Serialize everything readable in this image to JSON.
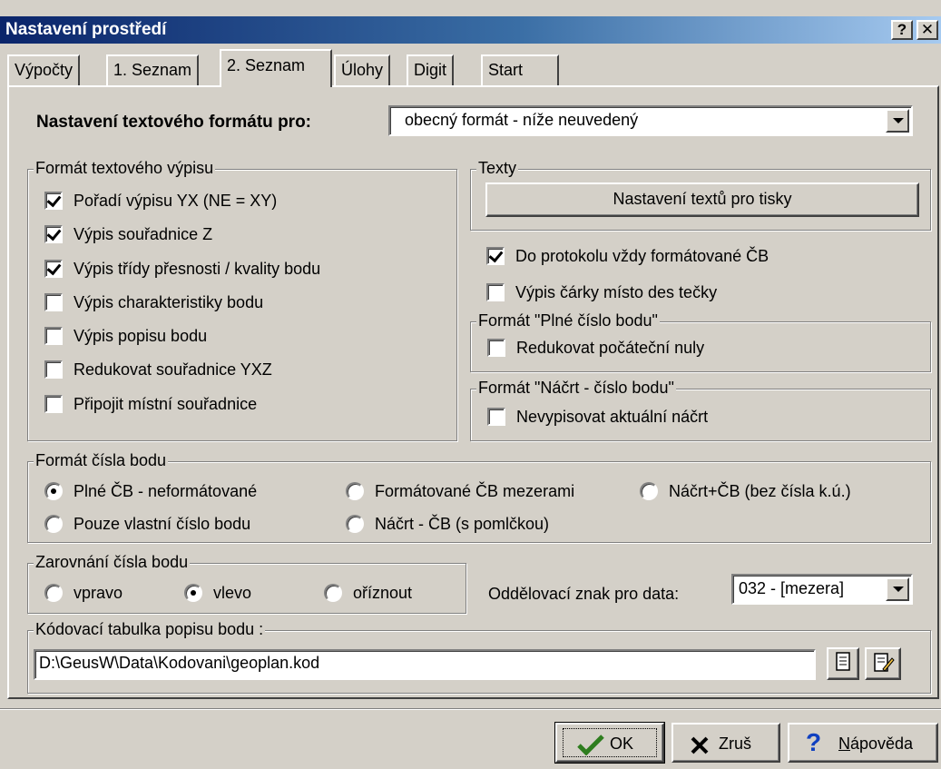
{
  "window": {
    "title": "Nastavení prostředí",
    "help_btn": "?",
    "close_btn": "✕"
  },
  "tabs": [
    {
      "label": "Výpočty"
    },
    {
      "label": "1. Seznam"
    },
    {
      "label": "2. Seznam"
    },
    {
      "label": "Úlohy"
    },
    {
      "label": "Digit"
    },
    {
      "label": "Start"
    }
  ],
  "active_tab": "2. Seznam",
  "format": {
    "label": "Nastavení textového formátu pro:",
    "value": "obecný formát - níže neuvedený"
  },
  "text_format_group": {
    "legend": "Formát textového výpisu",
    "items": [
      {
        "label": "Pořadí výpisu YX (NE = XY)",
        "checked": true
      },
      {
        "label": "Výpis souřadnice Z",
        "checked": true
      },
      {
        "label": "Výpis třídy přesnosti / kvality bodu",
        "checked": true
      },
      {
        "label": "Výpis charakteristiky bodu",
        "checked": false
      },
      {
        "label": "Výpis popisu bodu",
        "checked": false
      },
      {
        "label": "Redukovat souřadnice YXZ",
        "checked": false
      },
      {
        "label": "Připojit místní souřadnice",
        "checked": false
      }
    ]
  },
  "texts_group": {
    "legend": "Texty",
    "button": "Nastavení textů pro tisky"
  },
  "right_checks": [
    {
      "label": "Do protokolu vždy formátované ČB",
      "checked": true
    },
    {
      "label": "Výpis čárky místo des tečky",
      "checked": false
    }
  ],
  "full_number_group": {
    "legend": "Formát \"Plné číslo bodu\"",
    "check": {
      "label": "Redukovat počáteční nuly",
      "checked": false
    }
  },
  "sketch_group": {
    "legend": "Formát \"Náčrt - číslo bodu\"",
    "check": {
      "label": "Nevypisovat aktuální náčrt",
      "checked": false
    }
  },
  "point_number_group": {
    "legend": "Formát čísla bodu",
    "options": [
      {
        "label": "Plné ČB - neformátované",
        "selected": true
      },
      {
        "label": "Formátované ČB mezerami",
        "selected": false
      },
      {
        "label": "Náčrt+ČB (bez čísla k.ú.)",
        "selected": false
      },
      {
        "label": "Pouze vlastní číslo bodu",
        "selected": false
      },
      {
        "label": "Náčrt - ČB (s pomlčkou)",
        "selected": false
      }
    ]
  },
  "alignment_group": {
    "legend": "Zarovnání čísla bodu",
    "options": [
      {
        "label": "vpravo",
        "selected": false
      },
      {
        "label": "vlevo",
        "selected": true
      },
      {
        "label": "oříznout",
        "selected": false
      }
    ]
  },
  "separator": {
    "label": "Oddělovací znak pro data:",
    "value": "032 - [mezera]"
  },
  "coding_group": {
    "legend": "Kódovací tabulka popisu bodu :",
    "path": "D:\\GeusW\\Data\\Kodovani\\geoplan.kod"
  },
  "buttons": {
    "ok": "OK",
    "cancel": "Zruš",
    "help_first": "N",
    "help_rest": "ápověda"
  },
  "colors": {
    "face": "#d4d0c8",
    "title_start": "#0a246a",
    "title_end": "#a6caf0",
    "ok_check": "#2e7d1e",
    "help_q": "#1040c0"
  }
}
